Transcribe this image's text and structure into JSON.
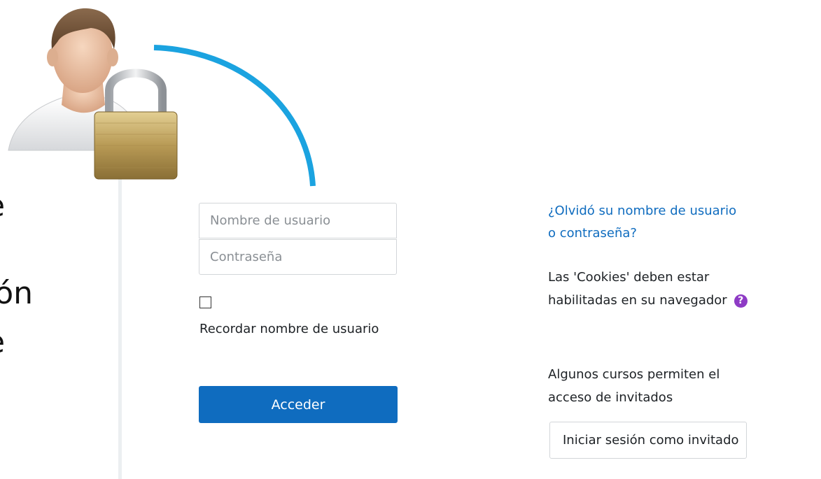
{
  "left_fragments": [
    "e",
    "ión",
    "e"
  ],
  "login": {
    "username_placeholder": "Nombre de usuario",
    "password_placeholder": "Contraseña",
    "remember_label": "Recordar nombre de usuario",
    "submit_label": "Acceder"
  },
  "info": {
    "forgot_link": "¿Olvidó su nombre de usuario o contraseña?",
    "cookies_text": "Las 'Cookies' deben estar habilitadas en su navegador",
    "help_icon_glyph": "?",
    "guest_text": "Algunos cursos permiten el acceso de invitados",
    "guest_button": "Iniciar sesión como invitado"
  },
  "colors": {
    "primary": "#0f6cbf",
    "arc": "#1ba3e0",
    "help": "#8e3bc5"
  },
  "icons": [
    "user-icon",
    "padlock-icon",
    "help-icon"
  ]
}
